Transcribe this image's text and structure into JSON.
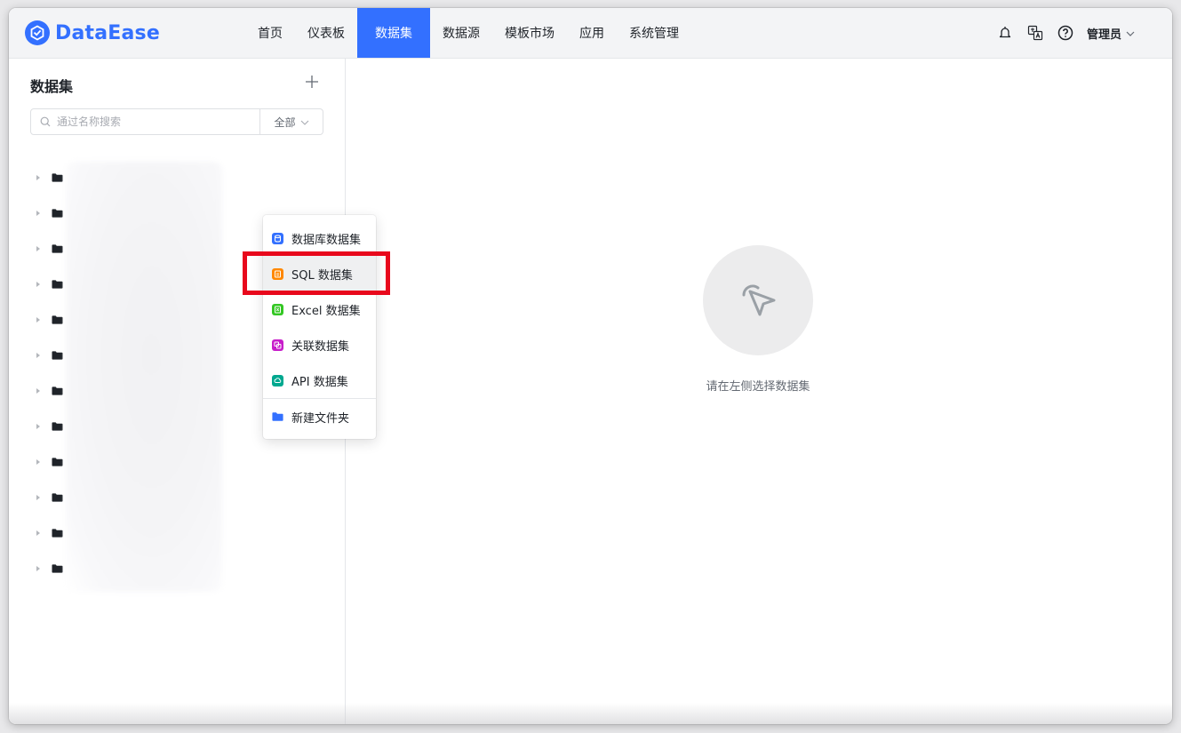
{
  "app": {
    "logo_text": "DataEase"
  },
  "nav": {
    "items": [
      {
        "label": "首页",
        "active": false
      },
      {
        "label": "仪表板",
        "active": false
      },
      {
        "label": "数据集",
        "active": true
      },
      {
        "label": "数据源",
        "active": false
      },
      {
        "label": "模板市场",
        "active": false
      },
      {
        "label": "应用",
        "active": false
      },
      {
        "label": "系统管理",
        "active": false
      }
    ],
    "accent_color": "#3370ff"
  },
  "header_right": {
    "icons": [
      "notification-bell-icon",
      "language-translate-icon",
      "help-question-icon"
    ],
    "user_name": "管理员"
  },
  "sidebar": {
    "title": "数据集",
    "add_icon": "plus-icon",
    "search": {
      "placeholder": "通过名称搜索",
      "value": "",
      "filter_label": "全部"
    },
    "tree_row_count": 12
  },
  "dropdown": {
    "items": [
      {
        "label": "数据库数据集",
        "icon": "database-dataset-icon",
        "color": "#3370ff"
      },
      {
        "label": "SQL 数据集",
        "icon": "sql-dataset-icon",
        "color": "#ff8800",
        "hovered": true
      },
      {
        "label": "Excel 数据集",
        "icon": "excel-dataset-icon",
        "color": "#34c724"
      },
      {
        "label": "关联数据集",
        "icon": "union-dataset-icon",
        "color": "#c71dca"
      },
      {
        "label": "API 数据集",
        "icon": "api-dataset-icon",
        "color": "#00a88f"
      }
    ],
    "folder_item": {
      "label": "新建文件夹",
      "icon": "folder-icon",
      "color": "#3370ff"
    },
    "highlight_color": "#e8081c"
  },
  "main": {
    "empty_icon": "pointer-click-icon",
    "empty_text": "请在左侧选择数据集"
  }
}
